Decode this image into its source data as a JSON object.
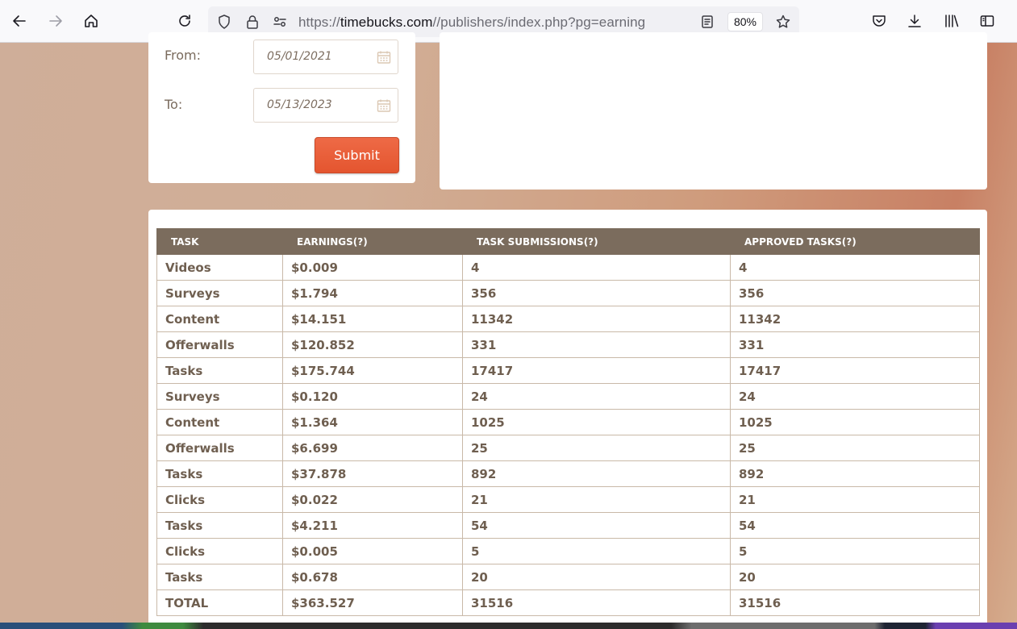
{
  "browser": {
    "url_prefix": "https://",
    "url_host": "timebucks.com",
    "url_path": "//publishers/index.php?pg=earning",
    "zoom": "80%"
  },
  "filter": {
    "from_label": "From:",
    "from_value": "05/01/2021",
    "to_label": "To:",
    "to_value": "05/13/2023",
    "submit_label": "Submit"
  },
  "table": {
    "headers": [
      "TASK",
      "EARNINGS(?)",
      "TASK SUBMISSIONS(?)",
      "APPROVED TASKS(?)"
    ],
    "rows": [
      [
        "Videos",
        "$0.009",
        "4",
        "4"
      ],
      [
        "Surveys",
        "$1.794",
        "356",
        "356"
      ],
      [
        "Content",
        "$14.151",
        "11342",
        "11342"
      ],
      [
        "Offerwalls",
        "$120.852",
        "331",
        "331"
      ],
      [
        "Tasks",
        "$175.744",
        "17417",
        "17417"
      ],
      [
        "Surveys",
        "$0.120",
        "24",
        "24"
      ],
      [
        "Content",
        "$1.364",
        "1025",
        "1025"
      ],
      [
        "Offerwalls",
        "$6.699",
        "25",
        "25"
      ],
      [
        "Tasks",
        "$37.878",
        "892",
        "892"
      ],
      [
        "Clicks",
        "$0.022",
        "21",
        "21"
      ],
      [
        "Tasks",
        "$4.211",
        "54",
        "54"
      ],
      [
        "Clicks",
        "$0.005",
        "5",
        "5"
      ],
      [
        "Tasks",
        "$0.678",
        "20",
        "20"
      ],
      [
        "TOTAL",
        "$363.527",
        "31516",
        "31516"
      ]
    ]
  },
  "colors": {
    "header_bg": "#7b6c5d",
    "cell_text": "#6f5f50",
    "submit_bg": "#e85c37"
  }
}
